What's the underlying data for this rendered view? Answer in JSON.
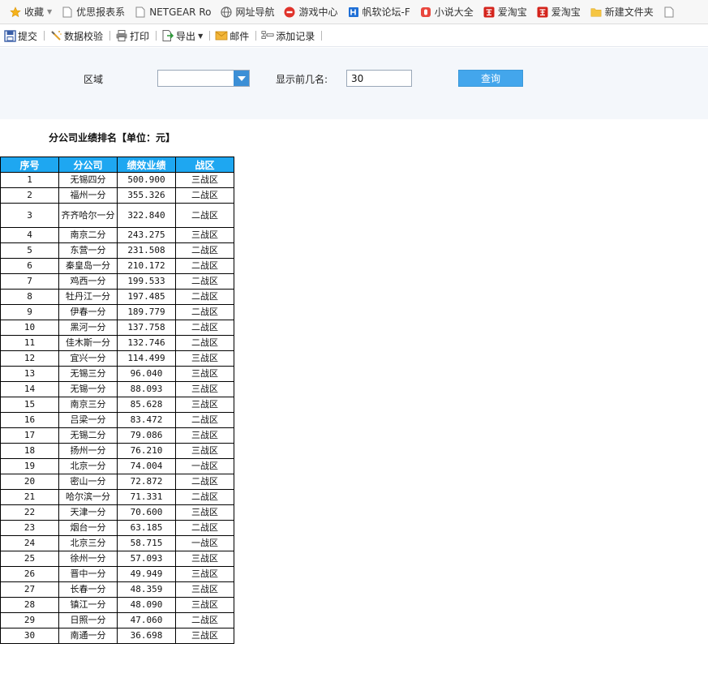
{
  "bookmarks": [
    {
      "label": "收藏",
      "icon": "star-icon"
    },
    {
      "label": "优思报表系",
      "icon": "page-icon"
    },
    {
      "label": "NETGEAR Ro",
      "icon": "page-icon"
    },
    {
      "label": "网址导航",
      "icon": "globe-icon"
    },
    {
      "label": "游戏中心",
      "icon": "game-icon"
    },
    {
      "label": "帆软论坛-F",
      "icon": "fanruan-icon"
    },
    {
      "label": "小说大全",
      "icon": "novel-icon"
    },
    {
      "label": "爱淘宝",
      "icon": "taobao-icon"
    },
    {
      "label": "爱淘宝",
      "icon": "taobao-icon"
    },
    {
      "label": "新建文件夹",
      "icon": "folder-icon"
    }
  ],
  "toolbar": {
    "submit": "提交",
    "validate": "数据校验",
    "print": "打印",
    "export": "导出",
    "mail": "邮件",
    "add_record": "添加记录"
  },
  "query": {
    "area_label": "区域",
    "area_value": "",
    "top_label": "显示前几名:",
    "top_value": "30",
    "button": "查询"
  },
  "report": {
    "title": "分公司业绩排名【单位：元】",
    "headers": [
      "序号",
      "分公司",
      "绩效业绩",
      "战区"
    ],
    "rows": [
      [
        "1",
        "无锡四分",
        "500.900",
        "三战区"
      ],
      [
        "2",
        "福州一分",
        "355.326",
        "二战区"
      ],
      [
        "3",
        "齐齐哈尔一分",
        "322.840",
        "二战区"
      ],
      [
        "4",
        "南京二分",
        "243.275",
        "三战区"
      ],
      [
        "5",
        "东营一分",
        "231.508",
        "二战区"
      ],
      [
        "6",
        "秦皇岛一分",
        "210.172",
        "二战区"
      ],
      [
        "7",
        "鸡西一分",
        "199.533",
        "二战区"
      ],
      [
        "8",
        "牡丹江一分",
        "197.485",
        "二战区"
      ],
      [
        "9",
        "伊春一分",
        "189.779",
        "二战区"
      ],
      [
        "10",
        "黑河一分",
        "137.758",
        "二战区"
      ],
      [
        "11",
        "佳木斯一分",
        "132.746",
        "二战区"
      ],
      [
        "12",
        "宜兴一分",
        "114.499",
        "三战区"
      ],
      [
        "13",
        "无锡三分",
        "96.040",
        "三战区"
      ],
      [
        "14",
        "无锡一分",
        "88.093",
        "三战区"
      ],
      [
        "15",
        "南京三分",
        "85.628",
        "三战区"
      ],
      [
        "16",
        "吕梁一分",
        "83.472",
        "二战区"
      ],
      [
        "17",
        "无锡二分",
        "79.086",
        "三战区"
      ],
      [
        "18",
        "扬州一分",
        "76.210",
        "三战区"
      ],
      [
        "19",
        "北京一分",
        "74.004",
        "一战区"
      ],
      [
        "20",
        "密山一分",
        "72.872",
        "二战区"
      ],
      [
        "21",
        "哈尔滨一分",
        "71.331",
        "二战区"
      ],
      [
        "22",
        "天津一分",
        "70.600",
        "三战区"
      ],
      [
        "23",
        "烟台一分",
        "63.185",
        "二战区"
      ],
      [
        "24",
        "北京三分",
        "58.715",
        "一战区"
      ],
      [
        "25",
        "徐州一分",
        "57.093",
        "三战区"
      ],
      [
        "26",
        "晋中一分",
        "49.949",
        "三战区"
      ],
      [
        "27",
        "长春一分",
        "48.359",
        "三战区"
      ],
      [
        "28",
        "镇江一分",
        "48.090",
        "三战区"
      ],
      [
        "29",
        "日照一分",
        "47.060",
        "二战区"
      ],
      [
        "30",
        "南通一分",
        "36.698",
        "三战区"
      ]
    ]
  }
}
